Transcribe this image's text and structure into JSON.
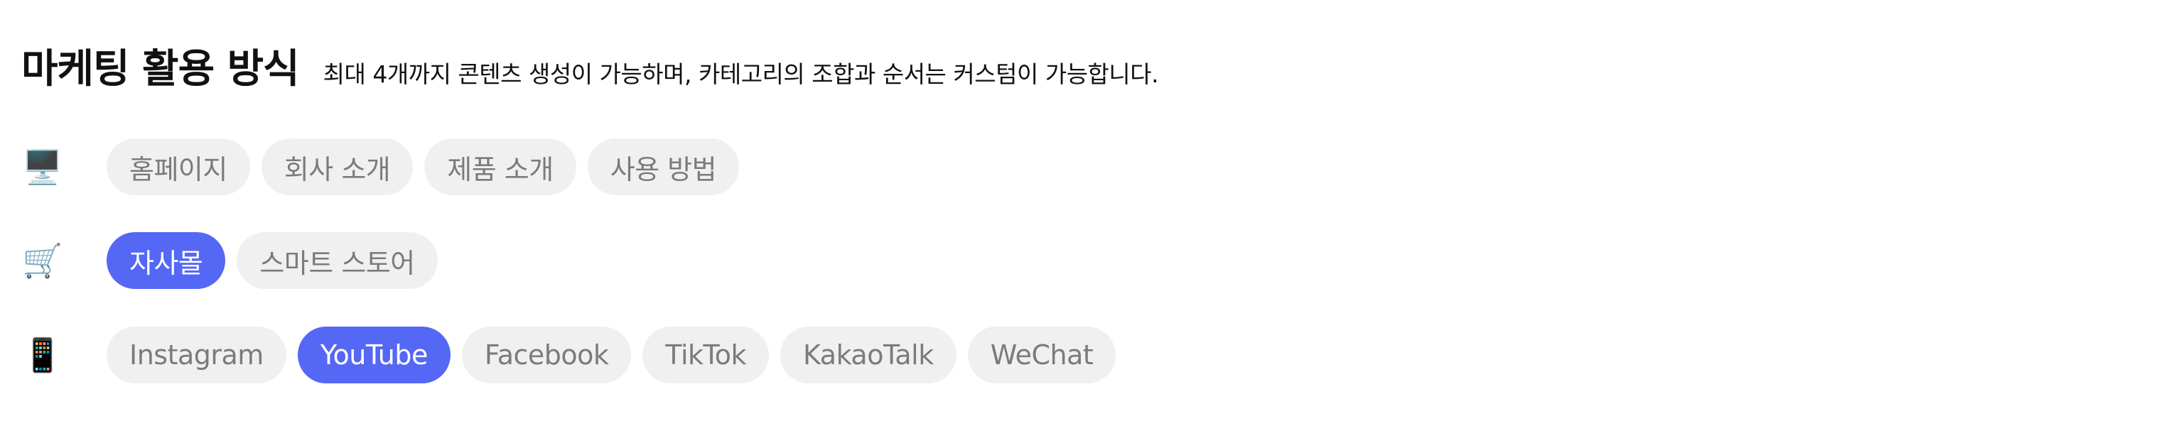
{
  "header": {
    "title": "마케팅 활용 방식",
    "subtitle": "최대 4개까지 콘텐츠 생성이 가능하며, 카테고리의 조합과 순서는 커스텀이 가능합니다."
  },
  "colors": {
    "active_chip": "#5567f5",
    "inactive_chip": "#f0f0f0",
    "inactive_text": "#7b7b7b"
  },
  "rows": [
    {
      "icon": "desktop-computer-icon",
      "glyph": "🖥️",
      "chips": [
        {
          "label": "홈페이지",
          "selected": false
        },
        {
          "label": "회사 소개",
          "selected": false
        },
        {
          "label": "제품 소개",
          "selected": false
        },
        {
          "label": "사용 방법",
          "selected": false
        }
      ]
    },
    {
      "icon": "shopping-cart-icon",
      "glyph": "🛒",
      "chips": [
        {
          "label": "자사몰",
          "selected": true
        },
        {
          "label": "스마트 스토어",
          "selected": false
        }
      ]
    },
    {
      "icon": "mobile-phone-icon",
      "glyph": "📱",
      "chips": [
        {
          "label": "Instagram",
          "selected": false
        },
        {
          "label": "YouTube",
          "selected": true
        },
        {
          "label": "Facebook",
          "selected": false
        },
        {
          "label": "TikTok",
          "selected": false
        },
        {
          "label": "KakaoTalk",
          "selected": false
        },
        {
          "label": "WeChat",
          "selected": false
        }
      ]
    }
  ]
}
